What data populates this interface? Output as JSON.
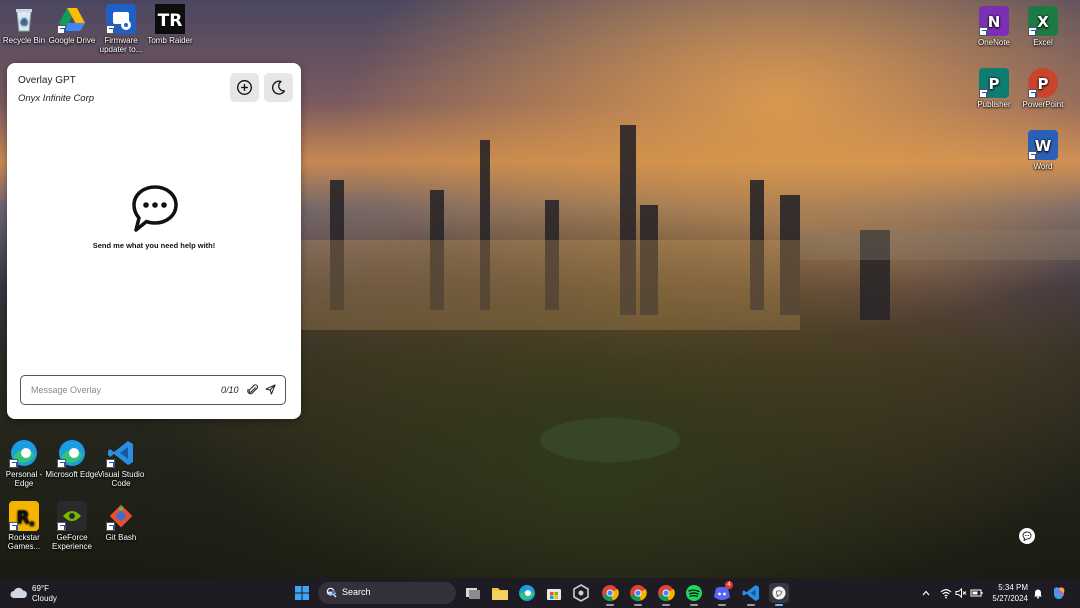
{
  "desktop": {
    "left_icons": [
      {
        "label": "Recycle Bin",
        "icon": "recycle-bin-icon"
      },
      {
        "label": "Google Drive",
        "icon": "google-drive-icon"
      },
      {
        "label": "Firmware updater to...",
        "icon": "firmware-updater-icon"
      },
      {
        "label": "Tomb Raider",
        "icon": "tomb-raider-icon"
      }
    ],
    "right_icons": [
      {
        "label": "OneNote",
        "icon": "onenote-icon"
      },
      {
        "label": "Excel",
        "icon": "excel-icon"
      },
      {
        "label": "Publisher",
        "icon": "publisher-icon"
      },
      {
        "label": "PowerPoint",
        "icon": "powerpoint-icon"
      },
      {
        "label": "Word",
        "icon": "word-icon"
      }
    ],
    "bottom_icons": [
      {
        "label": "Personal - Edge",
        "icon": "edge-personal-icon"
      },
      {
        "label": "Microsoft Edge",
        "icon": "edge-icon"
      },
      {
        "label": "Visual Studio Code",
        "icon": "vscode-icon"
      },
      {
        "label": "Rockstar Games...",
        "icon": "rockstar-icon"
      },
      {
        "label": "GeForce Experience",
        "icon": "geforce-icon"
      },
      {
        "label": "Git Bash",
        "icon": "git-bash-icon"
      }
    ]
  },
  "overlay": {
    "title": "Overlay GPT",
    "subtitle": "Onyx Infinite Corp",
    "new_chat_icon": "plus-circle-icon",
    "theme_icon": "moon-icon",
    "empty_icon": "chat-bubble-icon",
    "empty_message": "Send me what you need help with!",
    "input_placeholder": "Message Overlay",
    "input_value": "",
    "char_count": "0/10",
    "attach_icon": "paperclip-icon",
    "send_icon": "send-icon"
  },
  "taskbar": {
    "weather_temp": "69°F",
    "weather_condition": "Cloudy",
    "search_label": "Search",
    "apps": [
      "start-icon",
      "search",
      "task-view-icon",
      "file-explorer-icon",
      "edge-icon",
      "store-icon",
      "app-icon",
      "chrome-icon",
      "chrome-icon",
      "chrome-icon",
      "spotify-icon",
      "discord-icon",
      "vscode-icon",
      "overlay-app-icon"
    ],
    "discord_badge": "4",
    "time": "5:34 PM",
    "date": "5/27/2024"
  },
  "colors": {
    "onenote": "#7b2fb5",
    "excel": "#1d7a45",
    "publisher": "#0d7c72",
    "powerpoint": "#c8442a",
    "word": "#2b5fb8",
    "taskbar": "#1e1b22"
  }
}
